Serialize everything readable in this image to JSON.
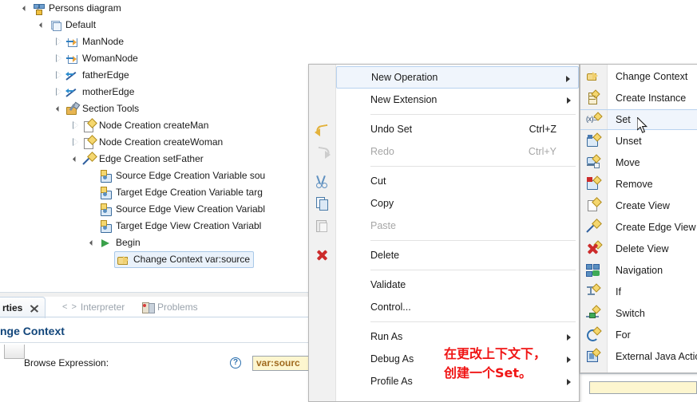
{
  "tree": {
    "items": [
      {
        "label": "Persons diagram",
        "depth": 0,
        "twisty": "open",
        "icon": "persons-diagram-icon",
        "selected": false
      },
      {
        "label": "Default",
        "depth": 1,
        "twisty": "open",
        "icon": "default-layer-icon",
        "selected": false
      },
      {
        "label": "ManNode",
        "depth": 2,
        "twisty": "closed",
        "icon": "node-mapping-icon",
        "selected": false
      },
      {
        "label": "WomanNode",
        "depth": 2,
        "twisty": "closed",
        "icon": "node-mapping-icon",
        "selected": false
      },
      {
        "label": "fatherEdge",
        "depth": 2,
        "twisty": "closed",
        "icon": "edge-mapping-icon",
        "selected": false
      },
      {
        "label": "motherEdge",
        "depth": 2,
        "twisty": "closed",
        "icon": "edge-mapping-icon",
        "selected": false
      },
      {
        "label": "Section Tools",
        "depth": 2,
        "twisty": "open",
        "icon": "section-tools-icon",
        "selected": false
      },
      {
        "label": "Node Creation createMan",
        "depth": 3,
        "twisty": "closed",
        "icon": "node-creation-icon",
        "selected": false
      },
      {
        "label": "Node Creation createWoman",
        "depth": 3,
        "twisty": "closed",
        "icon": "node-creation-icon",
        "selected": false
      },
      {
        "label": "Edge Creation setFather",
        "depth": 3,
        "twisty": "open",
        "icon": "edge-creation-icon",
        "selected": false
      },
      {
        "label": "Source Edge Creation Variable sou",
        "depth": 4,
        "twisty": "none",
        "icon": "variable-icon",
        "selected": false
      },
      {
        "label": "Target Edge Creation Variable targ",
        "depth": 4,
        "twisty": "none",
        "icon": "variable-icon",
        "selected": false
      },
      {
        "label": "Source Edge View Creation Variabl",
        "depth": 4,
        "twisty": "none",
        "icon": "variable-icon",
        "selected": false
      },
      {
        "label": "Target Edge View Creation Variabl",
        "depth": 4,
        "twisty": "none",
        "icon": "variable-icon",
        "selected": false
      },
      {
        "label": "Begin",
        "depth": 4,
        "twisty": "open",
        "icon": "begin-icon",
        "selected": false
      },
      {
        "label": "Change Context var:source",
        "depth": 5,
        "twisty": "none",
        "icon": "change-context-icon",
        "selected": true
      }
    ]
  },
  "context_menu": {
    "items": [
      {
        "label": "New Operation",
        "accel": "",
        "icon": "",
        "submenu": true,
        "disabled": false,
        "highlighted": true,
        "sep_after": false
      },
      {
        "label": "New Extension",
        "accel": "",
        "icon": "",
        "submenu": true,
        "disabled": false,
        "highlighted": false,
        "sep_after": true
      },
      {
        "label": "Undo Set",
        "accel": "Ctrl+Z",
        "icon": "undo-icon",
        "submenu": false,
        "disabled": false,
        "highlighted": false,
        "sep_after": false
      },
      {
        "label": "Redo",
        "accel": "Ctrl+Y",
        "icon": "redo-icon",
        "submenu": false,
        "disabled": true,
        "highlighted": false,
        "sep_after": true
      },
      {
        "label": "Cut",
        "accel": "",
        "icon": "cut-icon",
        "submenu": false,
        "disabled": false,
        "highlighted": false,
        "sep_after": false
      },
      {
        "label": "Copy",
        "accel": "",
        "icon": "copy-icon",
        "submenu": false,
        "disabled": false,
        "highlighted": false,
        "sep_after": false
      },
      {
        "label": "Paste",
        "accel": "",
        "icon": "paste-icon",
        "submenu": false,
        "disabled": true,
        "highlighted": false,
        "sep_after": true
      },
      {
        "label": "Delete",
        "accel": "",
        "icon": "delete-icon",
        "submenu": false,
        "disabled": false,
        "highlighted": false,
        "sep_after": true
      },
      {
        "label": "Validate",
        "accel": "",
        "icon": "",
        "submenu": false,
        "disabled": false,
        "highlighted": false,
        "sep_after": false
      },
      {
        "label": "Control...",
        "accel": "",
        "icon": "",
        "submenu": false,
        "disabled": false,
        "highlighted": false,
        "sep_after": true
      },
      {
        "label": "Run As",
        "accel": "",
        "icon": "",
        "submenu": true,
        "disabled": false,
        "highlighted": false,
        "sep_after": false
      },
      {
        "label": "Debug As",
        "accel": "",
        "icon": "",
        "submenu": true,
        "disabled": false,
        "highlighted": false,
        "sep_after": false
      },
      {
        "label": "Profile As",
        "accel": "",
        "icon": "",
        "submenu": true,
        "disabled": false,
        "highlighted": false,
        "sep_after": false
      }
    ]
  },
  "submenu": {
    "items": [
      {
        "label": "Change Context",
        "icon": "change-context-icon",
        "highlighted": false
      },
      {
        "label": "Create Instance",
        "icon": "create-instance-icon",
        "highlighted": false
      },
      {
        "label": "Set",
        "icon": "set-icon",
        "highlighted": true
      },
      {
        "label": "Unset",
        "icon": "unset-icon",
        "highlighted": false
      },
      {
        "label": "Move",
        "icon": "move-icon",
        "highlighted": false
      },
      {
        "label": "Remove",
        "icon": "remove-icon",
        "highlighted": false
      },
      {
        "label": "Create View",
        "icon": "create-view-icon",
        "highlighted": false
      },
      {
        "label": "Create Edge View",
        "icon": "create-edge-view-icon",
        "highlighted": false
      },
      {
        "label": "Delete View",
        "icon": "delete-view-icon",
        "highlighted": false
      },
      {
        "label": "Navigation",
        "icon": "navigation-icon",
        "highlighted": false
      },
      {
        "label": "If",
        "icon": "if-icon",
        "highlighted": false
      },
      {
        "label": "Switch",
        "icon": "switch-icon",
        "highlighted": false
      },
      {
        "label": "For",
        "icon": "for-icon",
        "highlighted": false
      },
      {
        "label": "External Java Action",
        "icon": "external-java-action-icon",
        "highlighted": false
      }
    ]
  },
  "properties": {
    "tabs": [
      {
        "label": "rties",
        "active": true,
        "icon": "close-x-icon"
      },
      {
        "label": "Interpreter",
        "active": false,
        "icon": "angle-brackets-icon"
      },
      {
        "label": "Problems",
        "active": false,
        "icon": "problems-icon"
      }
    ],
    "title": "nge Context",
    "field_label": "Browse Expression:",
    "field_value": "var:sourc",
    "help_icon": "?"
  },
  "annotation": {
    "text": "在更改上下文下，\n创建一个Set。",
    "color": "#f01515"
  },
  "colors": {
    "selection_blue": "#eaf2fb",
    "selection_border": "#a8c8e8",
    "menu_bg": "#ffffff",
    "menu_gutter": "#f1f1f1",
    "highlight_bg": "#f0f5fc",
    "highlight_border": "#b8d2ef",
    "title_blue": "#11457a",
    "field_yellow": "#fdf6cf"
  }
}
